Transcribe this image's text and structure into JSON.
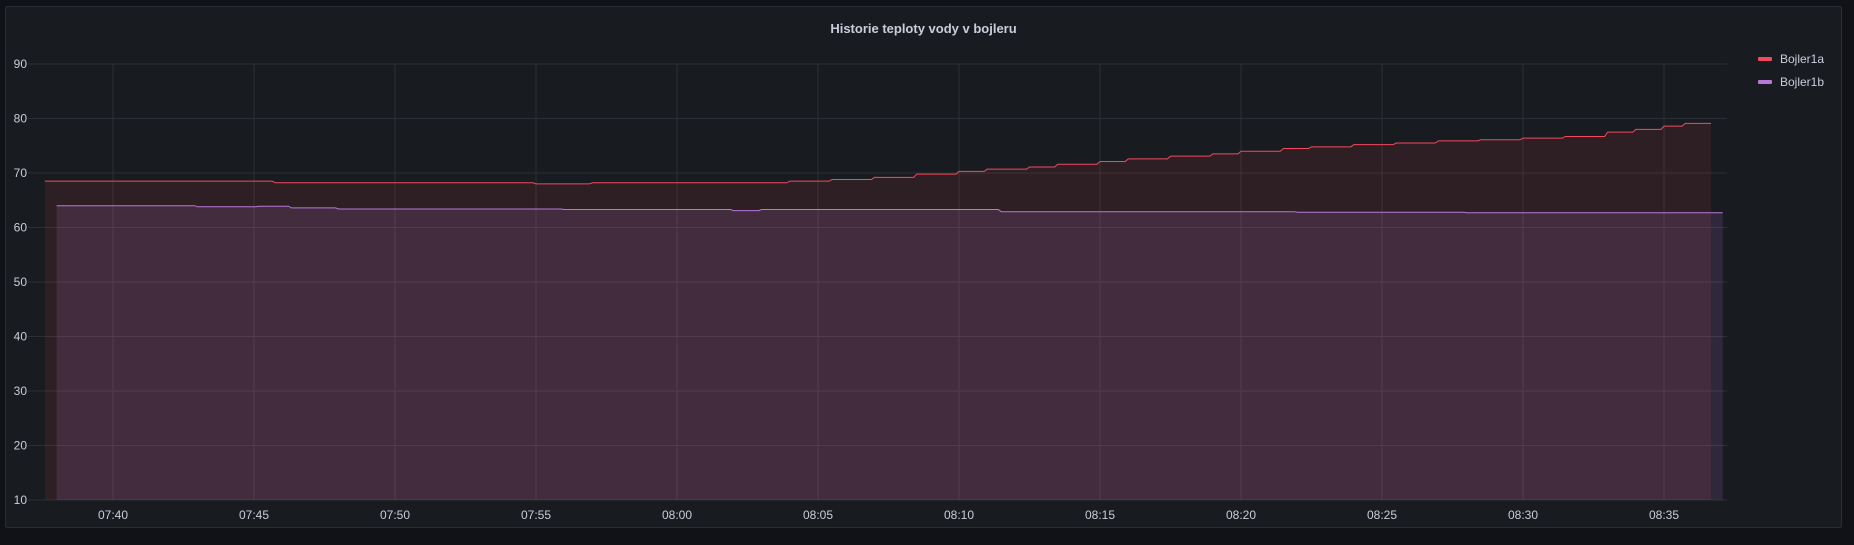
{
  "colors": {
    "background": "#111217",
    "panel": "#181b1f",
    "grid": "#2c2f35"
  },
  "chart_data": {
    "type": "line",
    "title": "Historie teploty vody v bojleru",
    "xlabel": "",
    "ylabel": "",
    "ylim": [
      10,
      90
    ],
    "xlim": [
      "07:37:00",
      "08:37:20"
    ],
    "grid": true,
    "legend_position": "right",
    "y_ticks": [
      "10",
      "20",
      "30",
      "40",
      "50",
      "60",
      "70",
      "80",
      "90"
    ],
    "x_ticks": [
      "07:40",
      "07:45",
      "07:50",
      "07:55",
      "08:00",
      "08:05",
      "08:10",
      "08:15",
      "08:20",
      "08:25",
      "08:30",
      "08:35"
    ],
    "series": [
      {
        "name": "Bojler1a",
        "color": "#f2495c",
        "fill_opacity": 0.1,
        "points": [
          [
            "07:37:35",
            68.5
          ],
          [
            "07:45:45",
            68.2
          ],
          [
            "07:55:00",
            68.0
          ],
          [
            "07:57:00",
            68.2
          ],
          [
            "08:04:00",
            68.5
          ],
          [
            "08:05:30",
            68.8
          ],
          [
            "08:07:00",
            69.2
          ],
          [
            "08:08:30",
            69.8
          ],
          [
            "08:10:00",
            70.3
          ],
          [
            "08:11:00",
            70.7
          ],
          [
            "08:12:30",
            71.1
          ],
          [
            "08:13:30",
            71.6
          ],
          [
            "08:15:00",
            72.1
          ],
          [
            "08:16:00",
            72.6
          ],
          [
            "08:17:30",
            73.1
          ],
          [
            "08:19:00",
            73.5
          ],
          [
            "08:20:00",
            74.0
          ],
          [
            "08:21:30",
            74.5
          ],
          [
            "08:22:30",
            74.8
          ],
          [
            "08:24:00",
            75.2
          ],
          [
            "08:25:30",
            75.5
          ],
          [
            "08:27:00",
            75.9
          ],
          [
            "08:28:30",
            76.1
          ],
          [
            "08:30:00",
            76.4
          ],
          [
            "08:31:30",
            76.7
          ],
          [
            "08:33:00",
            77.5
          ],
          [
            "08:34:00",
            78.0
          ],
          [
            "08:35:00",
            78.6
          ],
          [
            "08:35:45",
            79.1
          ],
          [
            "08:36:40",
            79.1
          ]
        ]
      },
      {
        "name": "Bojler1b",
        "color": "#b877d9",
        "fill_opacity": 0.15,
        "points": [
          [
            "07:38:00",
            64.0
          ],
          [
            "07:43:00",
            63.8
          ],
          [
            "07:45:10",
            63.9
          ],
          [
            "07:46:20",
            63.6
          ],
          [
            "07:48:00",
            63.4
          ],
          [
            "07:56:00",
            63.3
          ],
          [
            "08:02:00",
            63.1
          ],
          [
            "08:03:00",
            63.3
          ],
          [
            "08:11:30",
            62.9
          ],
          [
            "08:22:00",
            62.8
          ],
          [
            "08:28:00",
            62.7
          ],
          [
            "08:37:05",
            62.7
          ]
        ]
      }
    ]
  }
}
